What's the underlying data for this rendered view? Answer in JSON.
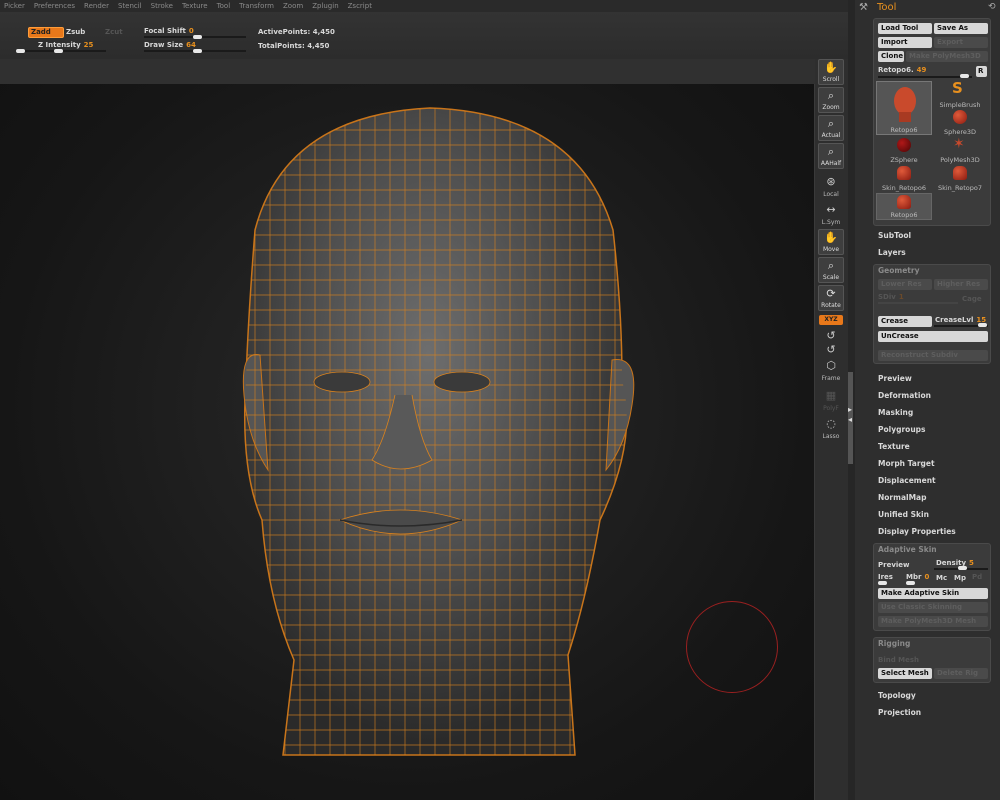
{
  "menu": [
    "Picker",
    "Preferences",
    "Render",
    "Stencil",
    "Stroke",
    "Texture",
    "Tool",
    "Transform",
    "Zoom",
    "Zplugin",
    "Zscript"
  ],
  "toolbar": {
    "zadd": "Zadd",
    "zsub": "Zsub",
    "zcut": "Zcut",
    "z_intensity_label": "Z Intensity",
    "z_intensity_value": "25",
    "focal_shift_label": "Focal Shift",
    "focal_shift_value": "0",
    "draw_size_label": "Draw Size",
    "draw_size_value": "64",
    "active_points": "ActivePoints: 4,450",
    "total_points": "TotalPoints: 4,450"
  },
  "shelf": {
    "scroll": "Scroll",
    "zoom": "Zoom",
    "actual": "Actual",
    "aahalf": "AAHalf",
    "local": "Local",
    "lsym": "L.Sym",
    "move": "Move",
    "scale": "Scale",
    "rotate": "Rotate",
    "xyz": "XYZ",
    "frame": "Frame",
    "poly": "PolyF",
    "lasso": "Lasso"
  },
  "palette": {
    "title": "Tool",
    "load_tool": "Load Tool",
    "save_as": "Save As",
    "import": "Import",
    "export": "Export",
    "clone": "Clone",
    "make_polymesh": "Make PolyMesh3D",
    "current_tool": "Retopo6.",
    "current_tool_value": "49",
    "r_button": "R",
    "meshes": [
      "Retopo6",
      "SimpleBrush",
      "Sphere3D",
      "ZSphere",
      "PolyMesh3D",
      "Skin_Retopo6",
      "Skin_Retopo7",
      "Retopo6"
    ],
    "subtool": "SubTool",
    "layers": "Layers",
    "geometry": {
      "title": "Geometry",
      "lower_res": "Lower Res",
      "higher_res": "Higher Res",
      "sdiv_label": "SDiv",
      "sdiv_value": "1",
      "cage": "Cage",
      "crease": "Crease",
      "crease_lvl_label": "CreaseLvl",
      "crease_lvl_value": "15",
      "uncrease": "UnCrease",
      "reconstruct": "Reconstruct Subdiv"
    },
    "sections_1": [
      "Preview",
      "Deformation",
      "Masking",
      "Polygroups",
      "Texture",
      "Morph Target",
      "Displacement",
      "NormalMap",
      "Unified Skin",
      "Display Properties"
    ],
    "adaptive_skin": {
      "title": "Adaptive Skin",
      "preview": "Preview",
      "density_label": "Density",
      "density_value": "5",
      "ires": "Ires",
      "mbr_label": "Mbr",
      "mbr_value": "0",
      "mc": "Mc",
      "mp": "Mp",
      "pd": "Pd",
      "make": "Make Adaptive Skin",
      "use_classic": "Use Classic Skinning",
      "make_polymesh": "Make PolyMesh3D Mesh"
    },
    "rigging": {
      "title": "Rigging",
      "bind_mesh": "Bind Mesh",
      "select_mesh": "Select Mesh",
      "delete_rig": "Delete Rig"
    },
    "sections_2": [
      "Topology",
      "Projection"
    ]
  }
}
